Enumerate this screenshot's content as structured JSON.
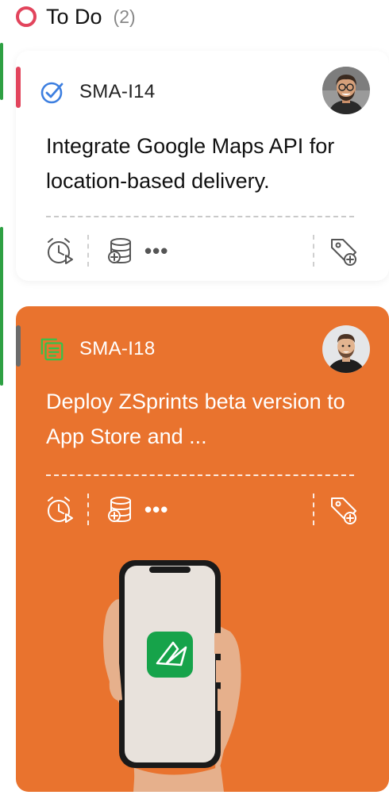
{
  "column": {
    "title": "To Do",
    "count": "(2)",
    "status_color": "#e2445c"
  },
  "cards": [
    {
      "id": "SMA-I14",
      "title": "Integrate Google Maps API for location-based delivery.",
      "type_icon": "check-circle-icon",
      "priority_color": "#e2445c",
      "background": "#ffffff"
    },
    {
      "id": "SMA-I18",
      "title": "Deploy ZSprints beta version to App Store and ...",
      "type_icon": "story-icon",
      "priority_color": "#6b6b6b",
      "background": "#e9732e"
    }
  ],
  "toolbar_icons": [
    "timer-icon",
    "database-add-icon",
    "more-icon",
    "tag-add-icon"
  ],
  "more_label": "•••",
  "accent_green": "#2ea043"
}
